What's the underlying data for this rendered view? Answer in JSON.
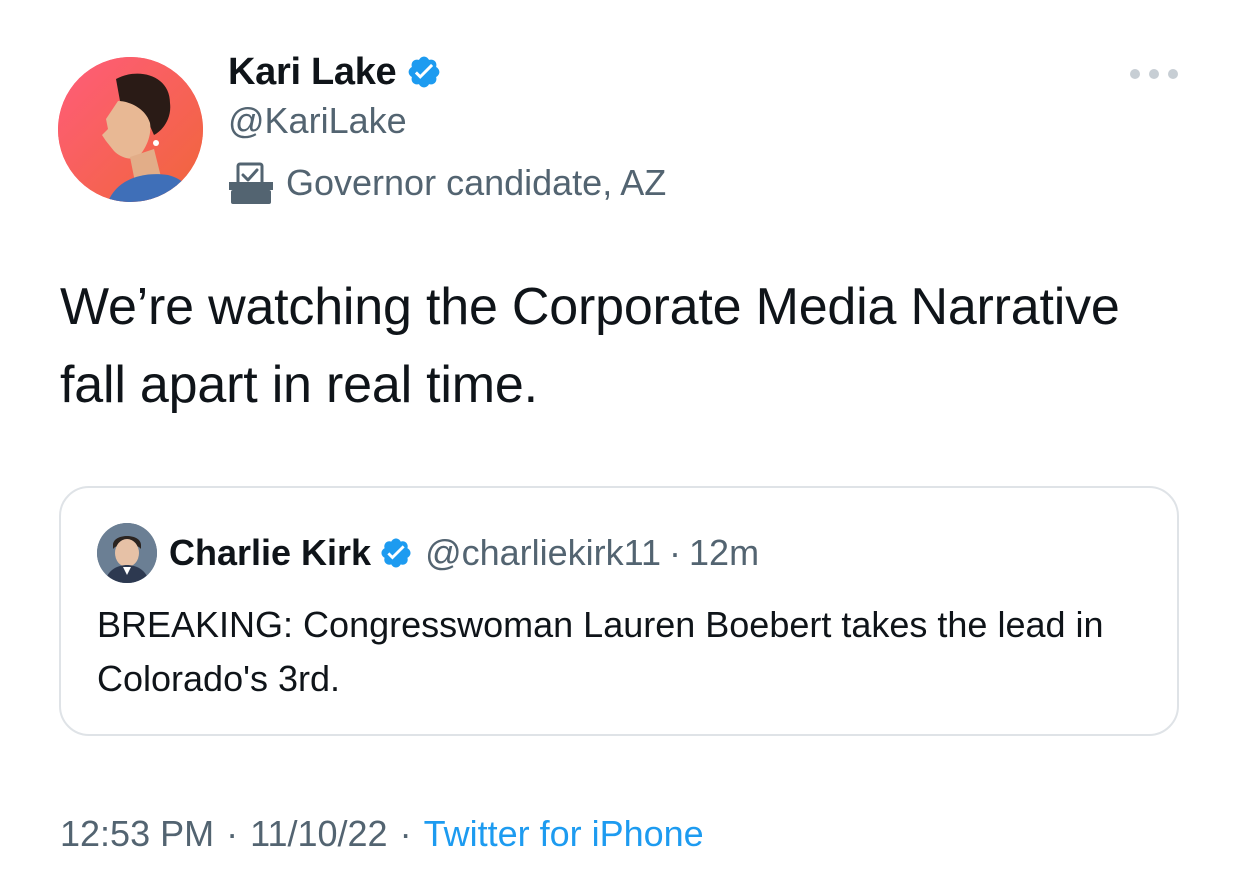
{
  "author": {
    "display_name": "Kari Lake",
    "handle": "@KariLake",
    "label": "Governor candidate, AZ",
    "verified_icon": "verified-badge-icon",
    "label_icon": "ballot-box-icon"
  },
  "more_icon": "more-dots-icon",
  "tweet": {
    "text": "We’re watching the Corporate Media Narrative fall apart in real time."
  },
  "quote": {
    "display_name": "Charlie Kirk",
    "handle": "@charliekirk11",
    "separator": "·",
    "time": "12m",
    "text": "BREAKING: Congresswoman Lauren Boebert takes the lead in Colorado's 3rd."
  },
  "footer": {
    "time": "12:53 PM",
    "separator_1": "·",
    "date": "11/10/22",
    "separator_2": "·",
    "source": "Twitter for iPhone"
  },
  "colors": {
    "verified": "#1d9bf0",
    "link": "#1d9bf0",
    "secondary_text": "#536471",
    "border": "#dfe3e7"
  }
}
